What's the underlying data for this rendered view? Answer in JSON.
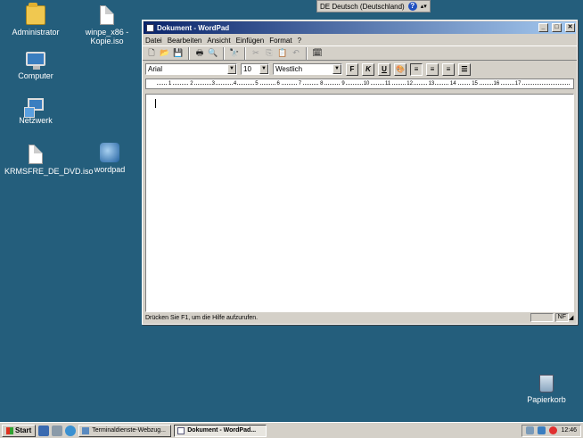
{
  "desktop": {
    "icons": [
      {
        "label": "Administrator"
      },
      {
        "label": "winpe_x86 - Kopie.iso"
      },
      {
        "label": "Computer"
      },
      {
        "label": "Netzwerk"
      },
      {
        "label": "KRMSFRE_DE_DVD.iso"
      },
      {
        "label": "wordpad"
      },
      {
        "label": "Papierkorb"
      }
    ]
  },
  "langbar": {
    "language": "DE Deutsch (Deutschland)",
    "help": "?"
  },
  "window": {
    "title": "Dokument - WordPad",
    "controls": {
      "minimize": "_",
      "maximize": "□",
      "close": "✕"
    },
    "menu": [
      "Datei",
      "Bearbeiten",
      "Ansicht",
      "Einfügen",
      "Format",
      "?"
    ],
    "format": {
      "font": "Arial",
      "size": "10",
      "script": "Westlich",
      "bold": "F",
      "italic": "K",
      "underline": "U"
    },
    "ruler": [
      "1",
      "2",
      "3",
      "4",
      "5",
      "6",
      "7",
      "8",
      "9",
      "10",
      "11",
      "12",
      "13",
      "14",
      "15",
      "16",
      "17"
    ],
    "status": {
      "message": "Drücken Sie F1, um die Hilfe aufzurufen.",
      "num": "NF"
    }
  },
  "taskbar": {
    "start": "Start",
    "tasks": [
      {
        "label": "Terminaldienste-Webzug..."
      },
      {
        "label": "Dokument - WordPad..."
      }
    ],
    "clock": "12:46"
  }
}
